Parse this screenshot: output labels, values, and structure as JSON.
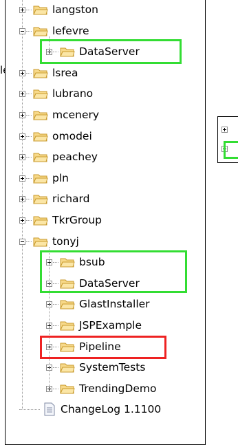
{
  "stray_text": "le",
  "tree": [
    {
      "label": "langston",
      "type": "folder",
      "level": 0,
      "state": "collapsed"
    },
    {
      "label": "lefevre",
      "type": "folder",
      "level": 0,
      "state": "expanded"
    },
    {
      "label": "DataServer",
      "type": "folder",
      "level": 1,
      "state": "collapsed",
      "highlight": "green"
    },
    {
      "label": "lsrea",
      "type": "folder",
      "level": 0,
      "state": "collapsed"
    },
    {
      "label": "lubrano",
      "type": "folder",
      "level": 0,
      "state": "collapsed"
    },
    {
      "label": "mcenery",
      "type": "folder",
      "level": 0,
      "state": "collapsed"
    },
    {
      "label": "omodei",
      "type": "folder",
      "level": 0,
      "state": "collapsed"
    },
    {
      "label": "peachey",
      "type": "folder",
      "level": 0,
      "state": "collapsed"
    },
    {
      "label": "pln",
      "type": "folder",
      "level": 0,
      "state": "collapsed"
    },
    {
      "label": "richard",
      "type": "folder",
      "level": 0,
      "state": "collapsed"
    },
    {
      "label": "TkrGroup",
      "type": "folder",
      "level": 0,
      "state": "collapsed"
    },
    {
      "label": "tonyj",
      "type": "folder",
      "level": 0,
      "state": "expanded"
    },
    {
      "label": "bsub",
      "type": "folder",
      "level": 1,
      "state": "collapsed",
      "highlight": "green"
    },
    {
      "label": "DataServer",
      "type": "folder",
      "level": 1,
      "state": "collapsed",
      "highlight": "green"
    },
    {
      "label": "GlastInstaller",
      "type": "folder",
      "level": 1,
      "state": "collapsed"
    },
    {
      "label": "JSPExample",
      "type": "folder",
      "level": 1,
      "state": "collapsed"
    },
    {
      "label": "Pipeline",
      "type": "folder",
      "level": 1,
      "state": "collapsed",
      "highlight": "red"
    },
    {
      "label": "SystemTests",
      "type": "folder",
      "level": 1,
      "state": "collapsed"
    },
    {
      "label": "TrendingDemo",
      "type": "folder",
      "level": 1,
      "state": "collapsed"
    },
    {
      "label": "ChangeLog 1.1100",
      "type": "file",
      "level": 0
    }
  ],
  "colors": {
    "highlight_green": "#33dd33",
    "highlight_red": "#ee2222",
    "folder_fill": "#f7d98a",
    "folder_stroke": "#c89a2c"
  }
}
